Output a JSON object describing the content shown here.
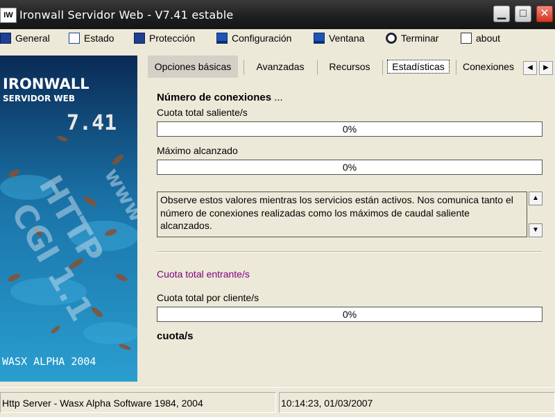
{
  "window": {
    "title": "Ironwall Servidor Web - V7.41 estable",
    "icon_text": "IW",
    "controls": [
      "minimize-icon",
      "maximize-icon",
      "close-icon"
    ]
  },
  "menu": {
    "items": [
      {
        "label": "General",
        "icon": "monitor-icon"
      },
      {
        "label": "Estado",
        "icon": "status-icon"
      },
      {
        "label": "Protección",
        "icon": "shield-icon"
      },
      {
        "label": "Configuración",
        "icon": "monitor-config-icon"
      },
      {
        "label": "Ventana",
        "icon": "window-icon"
      },
      {
        "label": "Terminar",
        "icon": "gear-icon"
      },
      {
        "label": "about",
        "icon": "house-icon"
      }
    ]
  },
  "splash": {
    "brand": "IRONWALL",
    "subtitle": "SERVIDOR WEB",
    "version": "7.41",
    "footer": "WASX ALPHA 2004",
    "watermark": [
      "www",
      "HTTP",
      "CGI 1.1"
    ]
  },
  "tabs": [
    {
      "label": "Opciones básicas"
    },
    {
      "label": "Avanzadas"
    },
    {
      "label": "Recursos"
    },
    {
      "label": "Estadísticas"
    },
    {
      "label": "Conexiones"
    }
  ],
  "stats": {
    "section_title": "Número de conexiones",
    "section_dots": "...",
    "out_label": "Cuota total saliente/s",
    "out_progress": {
      "value": 0,
      "text": "0%"
    },
    "max_label": "Máximo alcanzado",
    "max_progress": {
      "value": 0,
      "text": "0%"
    },
    "info_text": "Observe estos valores mientras los servicios están activos. Nos comunica tanto el número de conexiones realizadas como los máximos de caudal saliente alcanzados.",
    "in_label": "Cuota total entrante/s",
    "in_label_color": "#800080",
    "client_label": "Cuota total por cliente/s",
    "client_progress": {
      "value": 0,
      "text": "0%"
    },
    "quota_label": "cuota/s"
  },
  "status": {
    "left": "Http Server - Wasx Alpha Software 1984, 2004",
    "right": "10:14:23, 01/03/2007"
  }
}
